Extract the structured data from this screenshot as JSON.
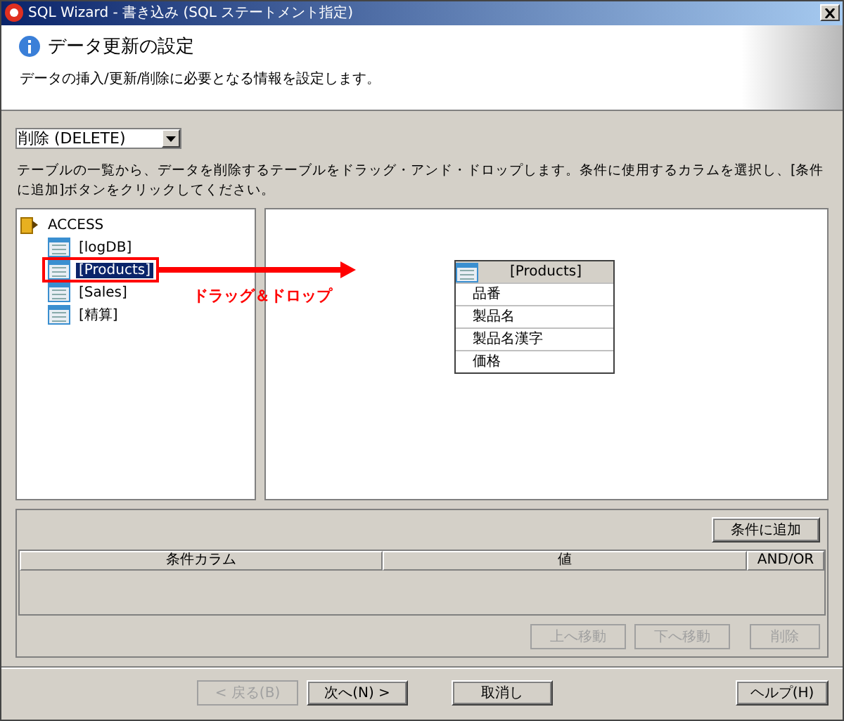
{
  "window": {
    "title": "SQL Wizard - 書き込み (SQL ステートメント指定)"
  },
  "header": {
    "title": "データ更新の設定",
    "description": "データの挿入/更新/削除に必要となる情報を設定します。"
  },
  "operation": {
    "value": "削除 (DELETE)"
  },
  "instruction": "テーブルの一覧から、データを削除するテーブルをドラッグ・アンド・ドロップします。条件に使用するカラムを選択し、[条件に追加]ボタンをクリックしてください。",
  "tree": {
    "label": "ACCESS",
    "children": [
      {
        "label": "[logDB]",
        "selected": false
      },
      {
        "label": "[Products]",
        "selected": true
      },
      {
        "label": "[Sales]",
        "selected": false
      },
      {
        "label": "[精算]",
        "selected": false
      }
    ]
  },
  "canvas_table": {
    "title": "[Products]",
    "columns": [
      "品番",
      "製品名",
      "製品名漢字",
      "価格"
    ]
  },
  "annotation": {
    "label": "ドラッグ＆ドロップ"
  },
  "add_condition_button": {
    "label": "条件に追加",
    "disabled": false
  },
  "conditions": {
    "columns": [
      "条件カラム",
      "値",
      "AND/OR"
    ]
  },
  "row_buttons": [
    {
      "label": "上へ移動",
      "disabled": true
    },
    {
      "label": "下へ移動",
      "disabled": true
    },
    {
      "label": "削除",
      "disabled": true
    }
  ],
  "footer_buttons": [
    {
      "label": "< 戻る(B)",
      "disabled": true
    },
    {
      "label": "次へ(N) >",
      "disabled": false
    },
    {
      "label": "取消し",
      "disabled": false
    },
    {
      "label": "ヘルプ(H)",
      "disabled": false
    }
  ]
}
